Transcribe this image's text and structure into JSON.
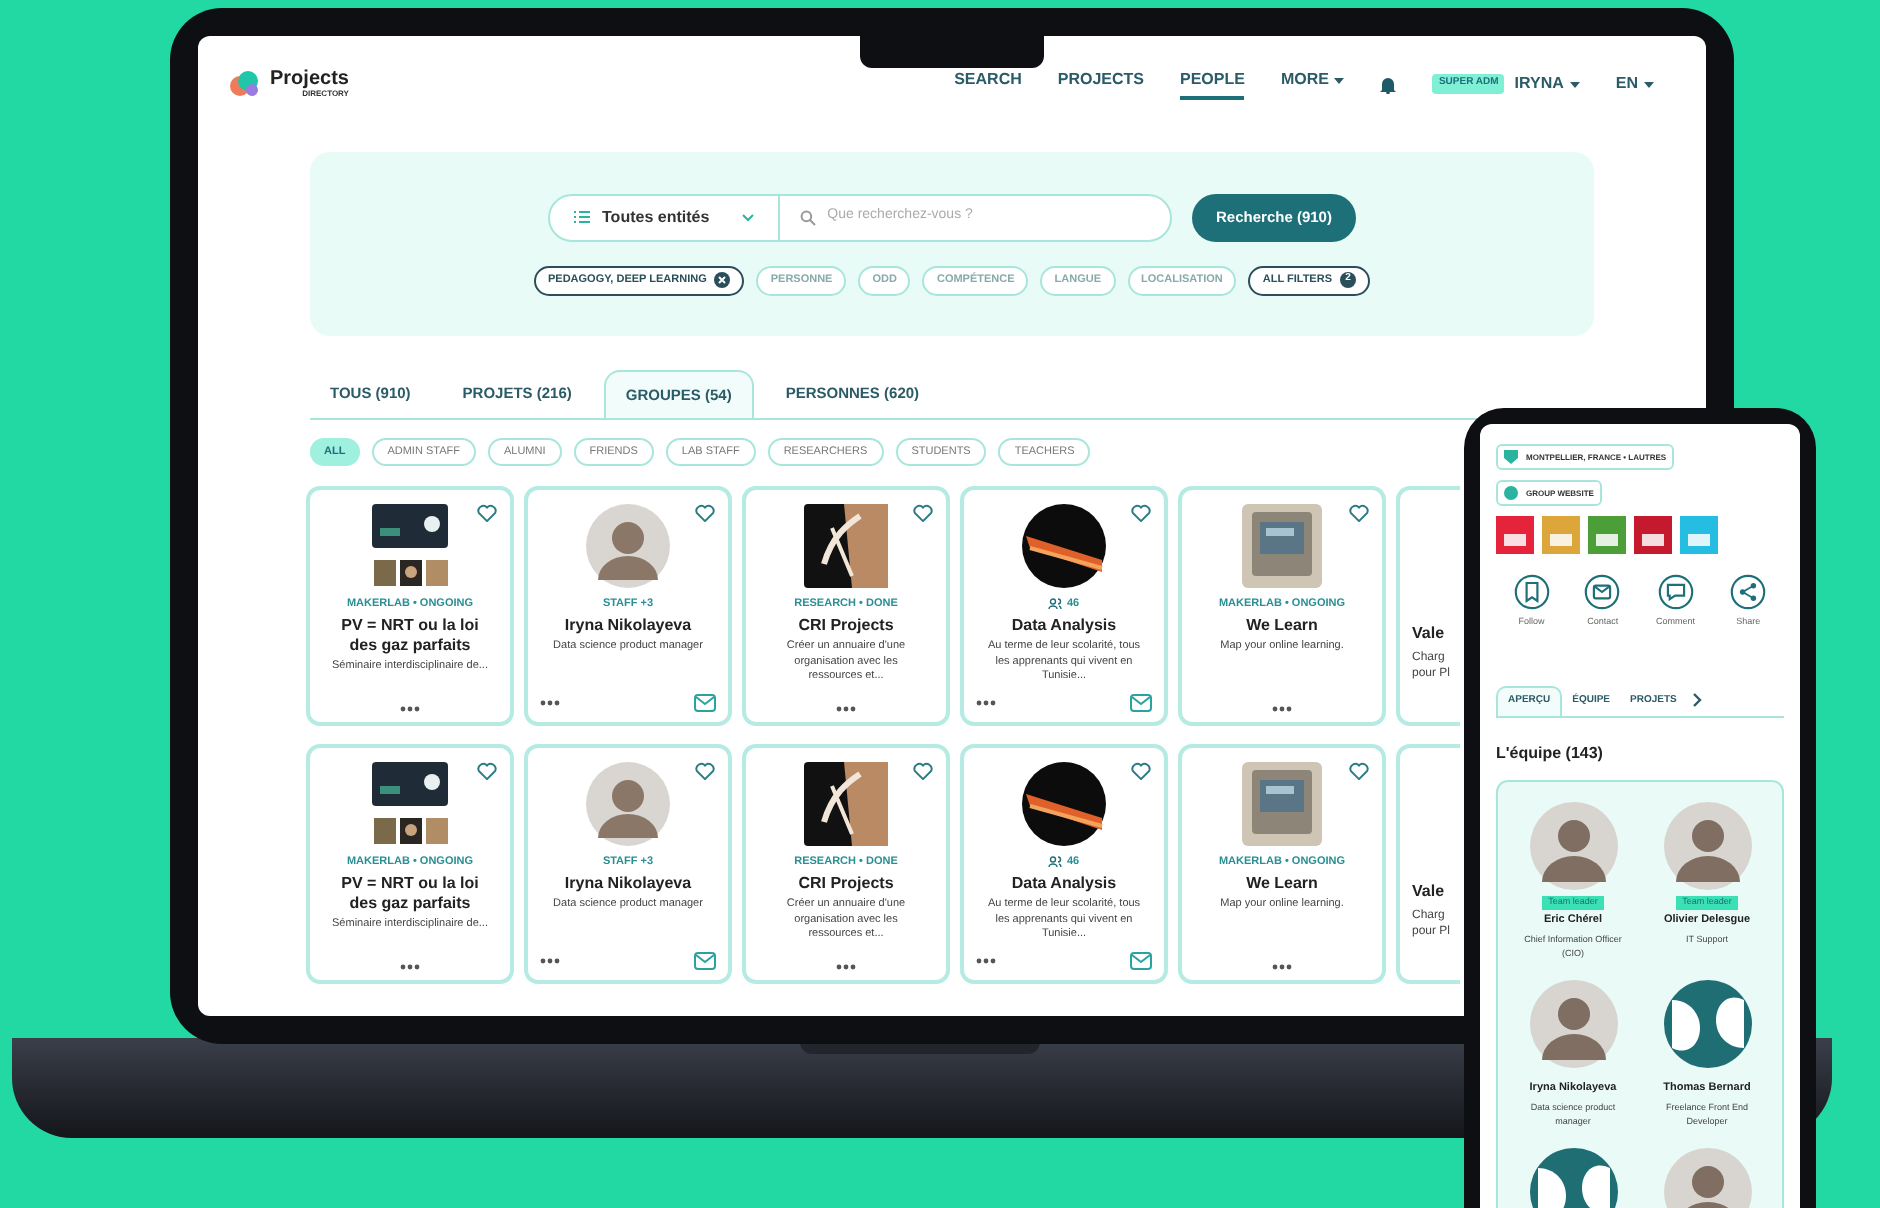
{
  "header": {
    "logo": {
      "title": "Projects",
      "subtitle": "DIRECTORY"
    },
    "nav": [
      {
        "label": "SEARCH",
        "selected": false,
        "kind": "link"
      },
      {
        "label": "PROJECTS",
        "selected": false,
        "kind": "link"
      },
      {
        "label": "PEOPLE",
        "selected": true,
        "kind": "link"
      },
      {
        "label": "MORE",
        "selected": false,
        "kind": "menu"
      }
    ],
    "role_badge": "SUPER ADM",
    "user": "IRYNA",
    "language": "EN"
  },
  "search": {
    "scope": "Toutes entités",
    "placeholder": "Que recherchez-vous ?",
    "button": "Recherche (910)"
  },
  "filters": [
    {
      "label": "PEDAGOGY, DEEP LEARNING",
      "active": true
    },
    {
      "label": "PERSONNE",
      "active": false
    },
    {
      "label": "ODD",
      "active": false
    },
    {
      "label": "COMPÉTENCE",
      "active": false
    },
    {
      "label": "LANGUE",
      "active": false
    },
    {
      "label": "LOCALISATION",
      "active": false
    },
    {
      "label": "ALL FILTERS",
      "active": true,
      "count": "2"
    }
  ],
  "tabs": [
    {
      "label": "TOUS (910)",
      "selected": false
    },
    {
      "label": "PROJETS (216)",
      "selected": false
    },
    {
      "label": "GROUPES (54)",
      "selected": true
    },
    {
      "label": "PERSONNES (620)",
      "selected": false
    }
  ],
  "categories": [
    {
      "label": "ALL",
      "selected": true
    },
    {
      "label": "ADMIN STAFF",
      "selected": false
    },
    {
      "label": "ALUMNI",
      "selected": false
    },
    {
      "label": "FRIENDS",
      "selected": false
    },
    {
      "label": "LAB STAFF",
      "selected": false
    },
    {
      "label": "RESEARCHERS",
      "selected": false
    },
    {
      "label": "STUDENTS",
      "selected": false
    },
    {
      "label": "TEACHERS",
      "selected": false
    }
  ],
  "card_rows": [
    [
      {
        "kind": "project",
        "tag": "MAKERLAB • ONGOING",
        "title": "PV = NRT ou la loi des gaz parfaits",
        "description": "Séminaire interdisciplinaire de..."
      },
      {
        "kind": "person",
        "tag": "STAFF +3",
        "title": "Iryna Nikolayeva",
        "description": "Data science product manager"
      },
      {
        "kind": "project",
        "tag": "RESEARCH • DONE",
        "title": "CRI Projects",
        "description": "Créer un annuaire d'une organisation avec les ressources et..."
      },
      {
        "kind": "group",
        "tag": "46",
        "title": "Data Analysis",
        "description": "Au terme de leur scolarité, tous les apprenants qui vivent en Tunisie..."
      },
      {
        "kind": "project",
        "tag": "MAKERLAB • ONGOING",
        "title": "We Learn",
        "description": "Map your online learning."
      },
      {
        "kind": "partial",
        "title": "Vale",
        "description": "Charg\npour Pl"
      }
    ],
    [
      {
        "kind": "project",
        "tag": "MAKERLAB • ONGOING",
        "title": "PV = NRT ou la loi des gaz parfaits",
        "description": "Séminaire interdisciplinaire de..."
      },
      {
        "kind": "person",
        "tag": "STAFF +3",
        "title": "Iryna Nikolayeva",
        "description": "Data science product manager"
      },
      {
        "kind": "project",
        "tag": "RESEARCH • DONE",
        "title": "CRI Projects",
        "description": "Créer un annuaire d'une organisation avec les ressources et..."
      },
      {
        "kind": "group",
        "tag": "46",
        "title": "Data Analysis",
        "description": "Au terme de leur scolarité, tous les apprenants qui vivent en Tunisie..."
      },
      {
        "kind": "project",
        "tag": "MAKERLAB • ONGOING",
        "title": "We Learn",
        "description": "Map your online learning."
      },
      {
        "kind": "partial",
        "title": "Vale",
        "description": "Charg\npour Pl"
      }
    ]
  ],
  "phone": {
    "location": "MONTPELLIER, FRANCE • LAUTRES",
    "website": "GROUP WEBSITE",
    "goals": [
      {
        "color": "#e5243b"
      },
      {
        "color": "#dda63a"
      },
      {
        "color": "#4c9f38"
      },
      {
        "color": "#c5192d"
      },
      {
        "color": "#26bde2"
      }
    ],
    "actions": [
      {
        "kind": "follow",
        "label": "Follow"
      },
      {
        "kind": "contact",
        "label": "Contact"
      },
      {
        "kind": "comment",
        "label": "Comment"
      },
      {
        "kind": "share",
        "label": "Share"
      }
    ],
    "tabs": [
      {
        "label": "APERÇU",
        "selected": true
      },
      {
        "label": "ÉQUIPE",
        "selected": false
      },
      {
        "label": "PROJETS",
        "selected": false
      }
    ],
    "team_title": "L'équipe (143)",
    "team": [
      {
        "name": "Eric Chérel",
        "badge": "Team leader",
        "role": "Chief Information Officer (CIO)"
      },
      {
        "name": "Olivier Delesgue",
        "badge": "Team leader",
        "role": "IT Support"
      },
      {
        "name": "Iryna Nikolayeva",
        "role": "Data science product manager"
      },
      {
        "name": "Thomas Bernard",
        "role": "Freelance Front End Developer"
      }
    ]
  }
}
